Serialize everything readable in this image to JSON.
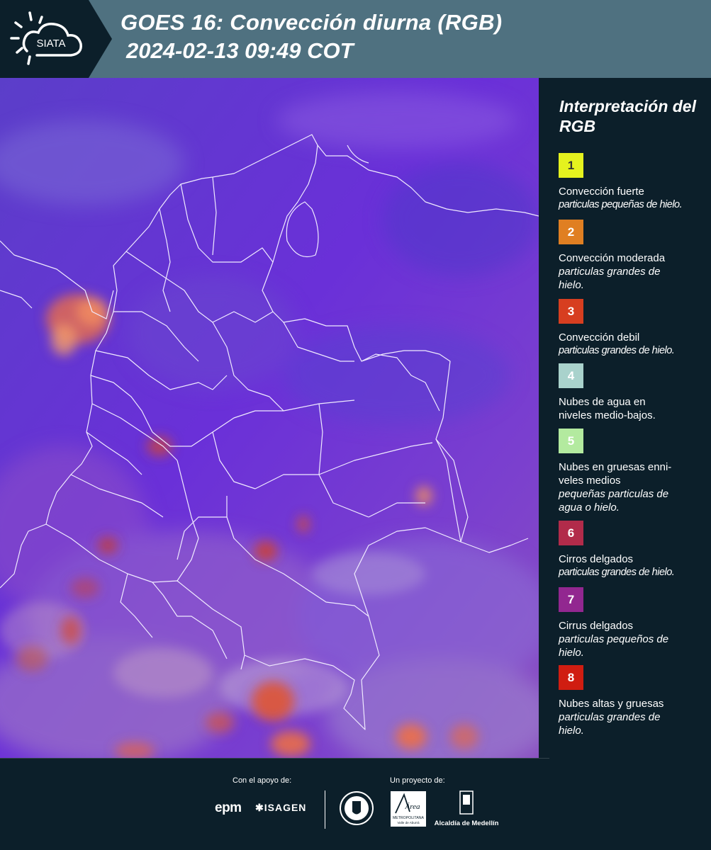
{
  "header": {
    "logo_text": "SIATA",
    "title": "GOES 16: Convección diurna (RGB)",
    "subtitle": "2024-02-13 09:49 COT"
  },
  "legend": {
    "title": "Interpretación del RGB",
    "items": [
      {
        "number": "1",
        "color": "#e5f21e",
        "text_color": "#333333",
        "name": "Convección fuerte",
        "desc": "particulas pequeñas de hielo."
      },
      {
        "number": "2",
        "color": "#e07f22",
        "text_color": "#ffffff",
        "name": "Convección moderada",
        "desc": "particulas grandes de hielo."
      },
      {
        "number": "3",
        "color": "#d73e20",
        "text_color": "#ffffff",
        "name": "Convección debil",
        "desc": "particulas grandes de hielo."
      },
      {
        "number": "4",
        "color": "#a9d2cc",
        "text_color": "#ffffff",
        "name": "Nubes de agua en niveles medio-bajos.",
        "desc": ""
      },
      {
        "number": "5",
        "color": "#b3ea9f",
        "text_color": "#ffffff",
        "name": "Nubes en gruesas enni-veles medios",
        "desc": "pequeñas particulas de agua o hielo."
      },
      {
        "number": "6",
        "color": "#b22b4a",
        "text_color": "#ffffff",
        "name": "Cirros delgados",
        "desc": "particulas grandes de hielo."
      },
      {
        "number": "7",
        "color": "#922790",
        "text_color": "#ffffff",
        "name": "Cirrus delgados",
        "desc": "particulas pequeños de hielo."
      },
      {
        "number": "8",
        "color": "#d01d11",
        "text_color": "#ffffff",
        "name": "Nubes altas y gruesas",
        "desc": "particulas grandes de hielo."
      }
    ]
  },
  "footer": {
    "support_label": "Con el apoyo de:",
    "project_label": "Un proyecto de:",
    "epm": "epm",
    "isagen": "ISAGEN",
    "alcaldia": "Alcaldía de Medellín",
    "metropolitana": "METROPOLITANA",
    "area_script": "Área",
    "valle": "Valle de Aburrá"
  }
}
